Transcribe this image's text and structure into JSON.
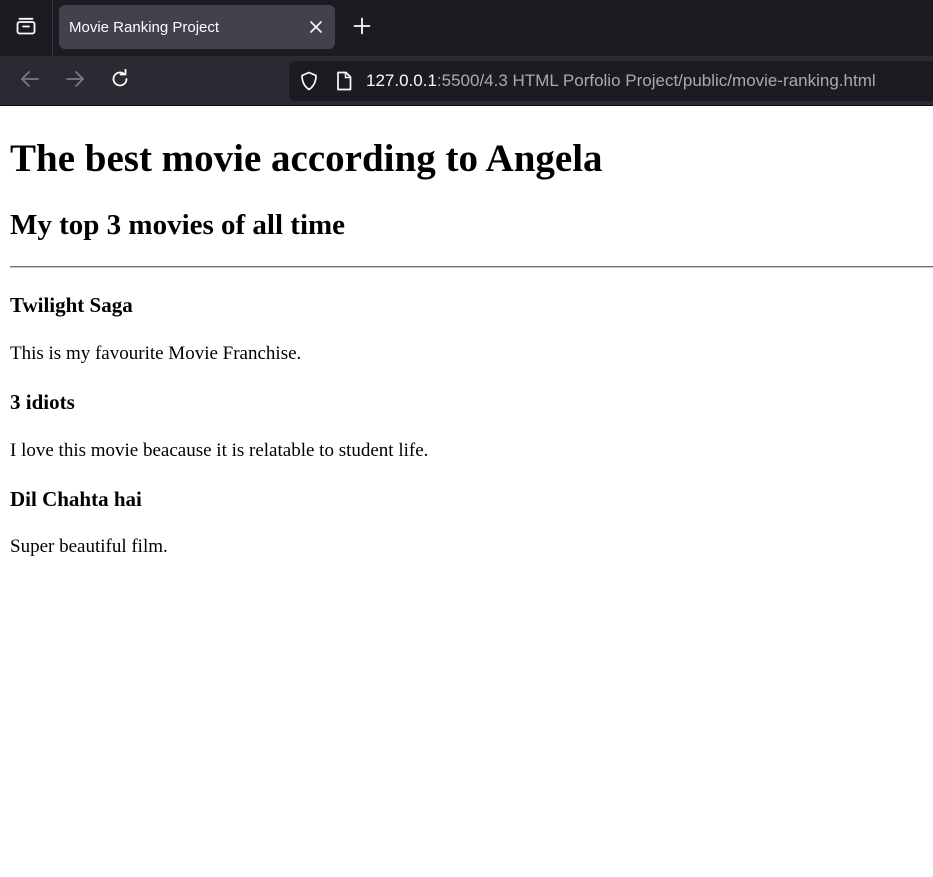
{
  "browser": {
    "tab": {
      "title": "Movie Ranking Project"
    },
    "url": {
      "host": "127.0.0.1",
      "path": ":5500/4.3 HTML Porfolio Project/public/movie-ranking.html"
    },
    "icons": [
      "tab-list-icon",
      "close-icon",
      "plus-icon",
      "back-arrow-icon",
      "forward-arrow-icon",
      "reload-icon",
      "shield-icon",
      "page-icon"
    ]
  },
  "page": {
    "title": "The best movie according to Angela",
    "subtitle": "My top 3 movies of all time",
    "movies": [
      {
        "name": "Twilight Saga",
        "description": "This is my favourite Movie Franchise."
      },
      {
        "name": "3 idiots",
        "description": "I love this movie beacause it is relatable to student life."
      },
      {
        "name": "Dil Chahta hai",
        "description": "Super beautiful film."
      }
    ]
  }
}
